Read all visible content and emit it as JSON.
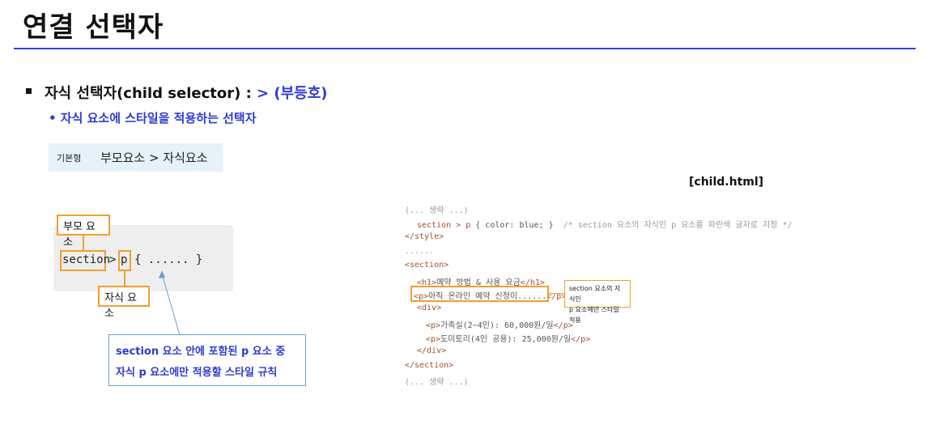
{
  "title": "연결 선택자",
  "bullet1": {
    "prefix": "자식 선택자(child selector) : ",
    "operator": "> (부등호)"
  },
  "bullet2": "• 자식 요소에 스타일을 적용하는 선택자",
  "basic": {
    "tag": "기본형",
    "expression": "부모요소 > 자식요소"
  },
  "file_label": "[child.html]",
  "diagram": {
    "parent_label": "부모 요소",
    "child_label": "자식 요소",
    "section": "section",
    "gt": ">",
    "p": "p",
    "rest": "{ ...... }",
    "callout_line1": "section 요소 안에 포함된 p 요소 중",
    "callout_line2": "자식 p 요소에만 적용할 스타일 규칙"
  },
  "code": {
    "l1": "(... 생략 ...)",
    "l2_sel": "section > p",
    "l2_body": " { color: blue; }",
    "l2_comment": "  /* section 요소의 자식인 p 요소를 파란색 글자로 지정 */",
    "l3": "</style>",
    "l4": "......",
    "l5": "<section>",
    "l6a": "<h1>",
    "l6b": "예약 방법 & 사용 요금",
    "l6c": "</h1>",
    "l7a": "<p>",
    "l7b": "아직 온라인 예약 신청이......",
    "l7c": "</p>",
    "l8": "<div>",
    "l9a": "<p>",
    "l9b": "가족실(2~4인): 60,000원/일",
    "l9c": "</p>",
    "l10a": "<p>",
    "l10b": "도미토리(4인 공용): 25,000원/일",
    "l10c": "</p>",
    "l11": "</div>",
    "l12": "</section>",
    "l13": "(... 생략 ...)",
    "note_line1": "section 요소의 자식인",
    "note_line2": "p 요소에만 스타일 적용"
  },
  "colors": {
    "accent": "#2e3bd1",
    "highlight": "#f0a030",
    "rule": "#3a3fd6"
  }
}
